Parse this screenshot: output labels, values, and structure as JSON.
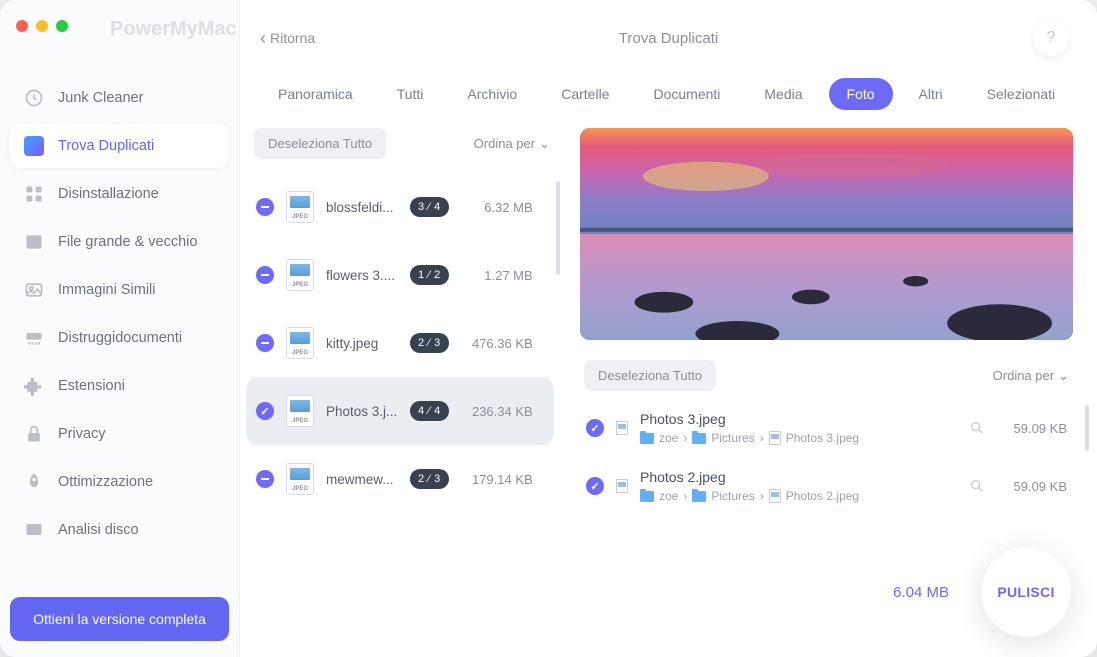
{
  "brand": "PowerMyMac",
  "back_label": "Ritorna",
  "page_title": "Trova Duplicati",
  "sidebar": {
    "items": [
      {
        "label": "Junk Cleaner"
      },
      {
        "label": "Trova Duplicati"
      },
      {
        "label": "Disinstallazione"
      },
      {
        "label": "File grande & vecchio"
      },
      {
        "label": "Immagini Simili"
      },
      {
        "label": "Distruggidocumenti"
      },
      {
        "label": "Estensioni"
      },
      {
        "label": "Privacy"
      },
      {
        "label": "Ottimizzazione"
      },
      {
        "label": "Analisi disco"
      }
    ],
    "cta": "Ottieni la versione completa"
  },
  "tabs": [
    "Panoramica",
    "Tutti",
    "Archivio",
    "Cartelle",
    "Documenti",
    "Media",
    "Foto",
    "Altri",
    "Selezionati"
  ],
  "active_tab": "Foto",
  "left": {
    "deselect": "Deseleziona Tutto",
    "sort": "Ordina per",
    "groups": [
      {
        "name": "blossfeldi...",
        "badge": "3 ⁄ 4",
        "size": "6.32 MB"
      },
      {
        "name": "flowers 3....",
        "badge": "1 ⁄ 2",
        "size": "1.27 MB"
      },
      {
        "name": "kitty.jpeg",
        "badge": "2 ⁄ 3",
        "size": "476.36 KB"
      },
      {
        "name": "Photos 3.j...",
        "badge": "4 ⁄ 4",
        "size": "236.34 KB"
      },
      {
        "name": "mewmew...",
        "badge": "2 ⁄ 3",
        "size": "179.14 KB"
      }
    ],
    "selected_index": 3
  },
  "right": {
    "deselect": "Deseleziona Tutto",
    "sort": "Ordina per",
    "items": [
      {
        "name": "Photos 3.jpeg",
        "path": [
          "zoe",
          "Pictures",
          "Photos 3.jpeg"
        ],
        "size": "59.09 KB"
      },
      {
        "name": "Photos 2.jpeg",
        "path": [
          "zoe",
          "Pictures",
          "Photos 2.jpeg"
        ],
        "size": "59.09 KB"
      }
    ]
  },
  "footer": {
    "total": "6.04 MB",
    "clean": "PULISCI"
  },
  "path_sep": "›"
}
